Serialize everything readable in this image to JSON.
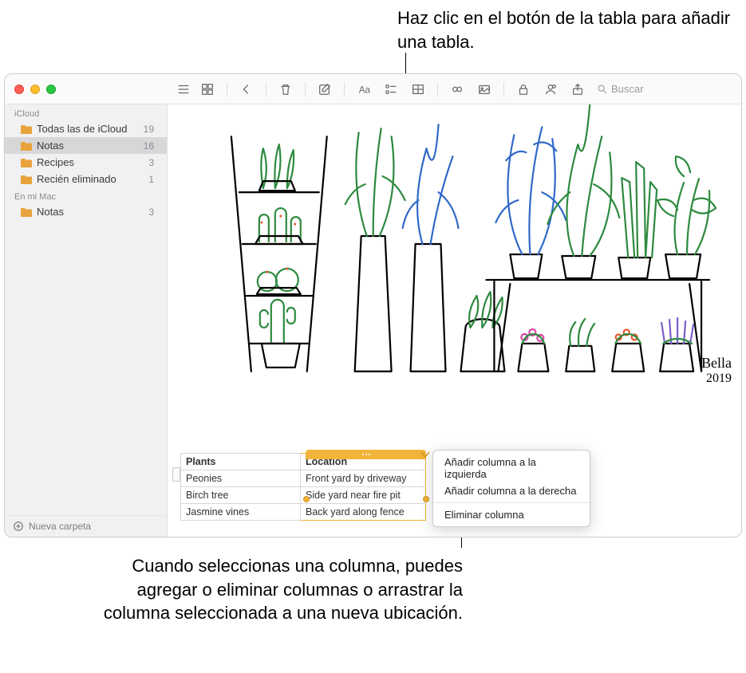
{
  "annotations": {
    "top": "Haz clic en el botón de la tabla para añadir una tabla.",
    "bottom": "Cuando seleccionas una columna, puedes agregar o eliminar columnas o arrastrar la columna seleccionada a una nueva ubicación."
  },
  "search": {
    "placeholder": "Buscar"
  },
  "sidebar": {
    "sections": [
      {
        "header": "iCloud",
        "items": [
          {
            "label": "Todas las de iCloud",
            "count": "19",
            "selected": false
          },
          {
            "label": "Notas",
            "count": "16",
            "selected": true
          },
          {
            "label": "Recipes",
            "count": "3",
            "selected": false
          },
          {
            "label": "Recién eliminado",
            "count": "1",
            "selected": false
          }
        ]
      },
      {
        "header": "En mi Mac",
        "items": [
          {
            "label": "Notas",
            "count": "3",
            "selected": false
          }
        ]
      }
    ],
    "footer": "Nueva carpeta"
  },
  "signature": "Bella\n2019",
  "table": {
    "headers": [
      "Plants",
      "Location"
    ],
    "rows": [
      [
        "Peonies",
        "Front yard by driveway"
      ],
      [
        "Birch tree",
        "Side yard near fire pit"
      ],
      [
        "Jasmine vines",
        "Back yard along fence"
      ]
    ]
  },
  "context_menu": {
    "items": [
      "Añadir columna a la izquierda",
      "Añadir columna a la derecha"
    ],
    "delete": "Eliminar columna"
  }
}
